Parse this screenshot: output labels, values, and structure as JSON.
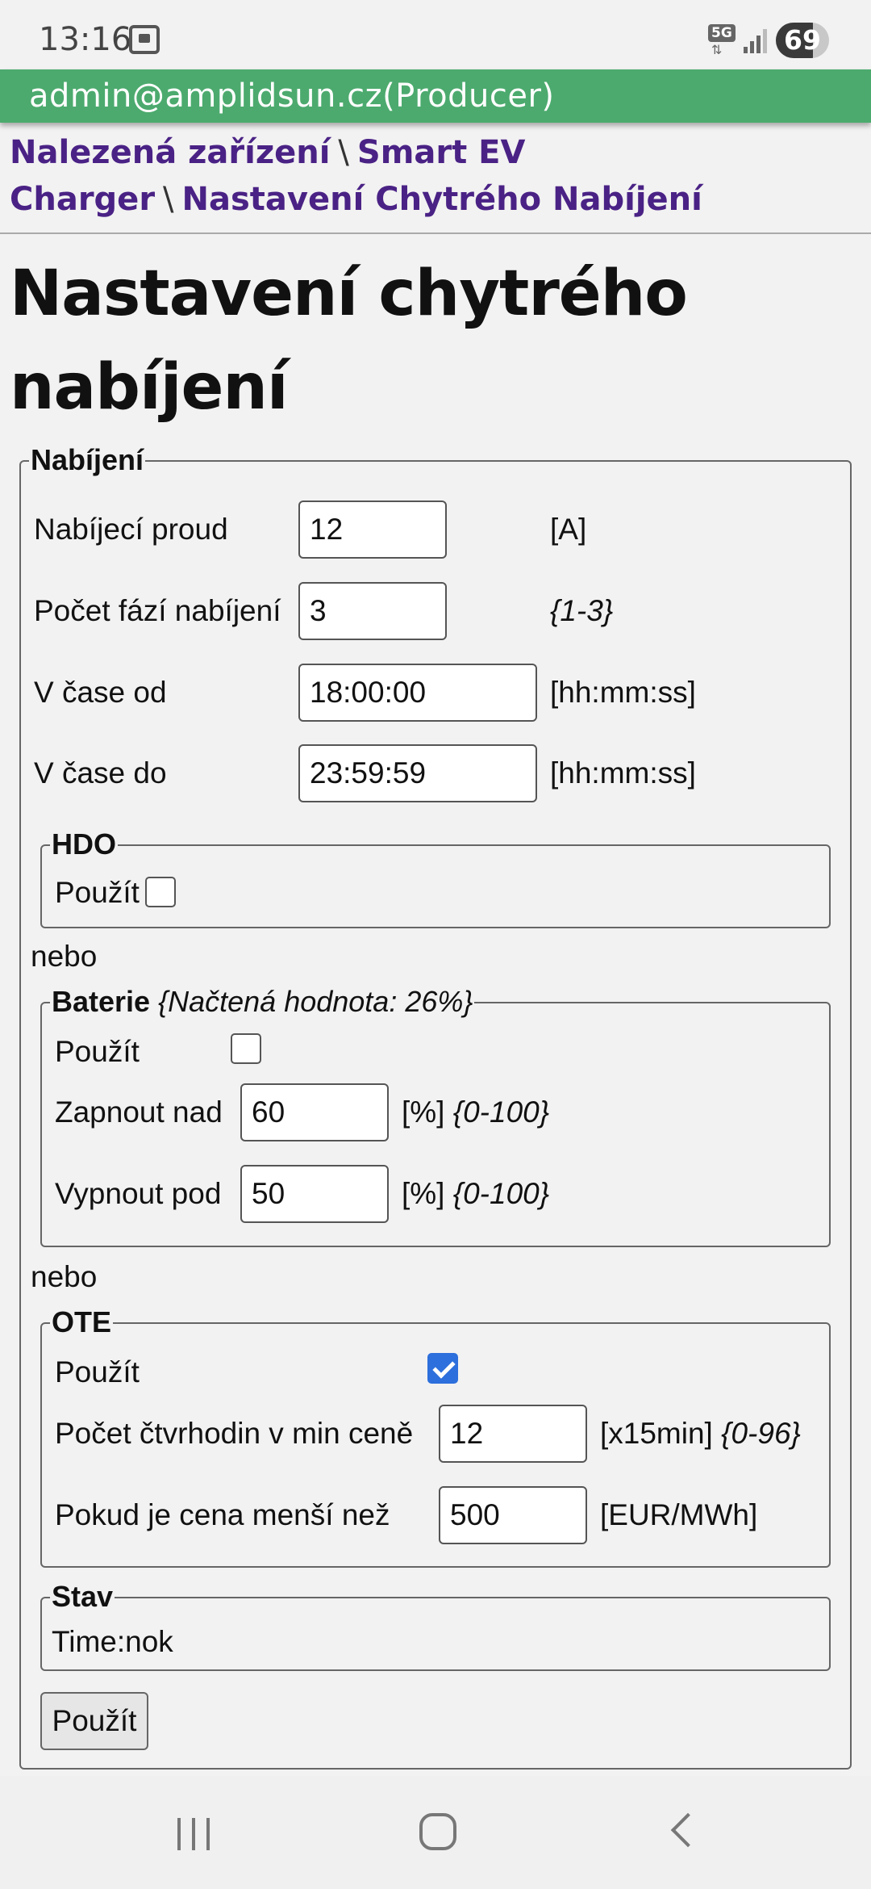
{
  "status": {
    "time": "13:16",
    "network": "5G",
    "battery": "69",
    "battery_level": 0.69
  },
  "header": {
    "user": "admin@amplidsun.cz(Producer)"
  },
  "breadcrumb": {
    "item1": "Nalezená zařízení",
    "item2": "Smart EV Charger",
    "item3": "Nastavení Chytrého Nabíjení",
    "separator": "\\"
  },
  "page": {
    "title": "Nastavení chytrého nabíjení",
    "or_label": "nebo"
  },
  "charging": {
    "legend": "Nabíjení",
    "current_label": "Nabíjecí proud",
    "current_value": "12",
    "current_unit": "[A]",
    "phases_label": "Počet fází nabíjení",
    "phases_value": "3",
    "phases_range": "{1-3}",
    "time_from_label": "V čase od",
    "time_from_value": "18:00:00",
    "time_from_unit": "[hh:mm:ss]",
    "time_to_label": "V čase do",
    "time_to_value": "23:59:59",
    "time_to_unit": "[hh:mm:ss]"
  },
  "hdo": {
    "legend": "HDO",
    "use_label": "Použít",
    "use_checked": false
  },
  "battery_section": {
    "legend": "Baterie",
    "loaded_value": "{Načtená hodnota: 26%}",
    "use_label": "Použít",
    "use_checked": false,
    "on_above_label": "Zapnout nad",
    "on_above_value": "60",
    "on_above_unit": "[%]",
    "on_above_range": "{0-100}",
    "off_below_label": "Vypnout pod",
    "off_below_value": "50",
    "off_below_unit": "[%]",
    "off_below_range": "{0-100}"
  },
  "ote": {
    "legend": "OTE",
    "use_label": "Použít",
    "use_checked": true,
    "quarters_label": "Počet čtvrhodin v min ceně",
    "quarters_value": "12",
    "quarters_unit": "[x15min]",
    "quarters_range": "{0-96}",
    "price_label": "Pokud je cena menší než",
    "price_value": "500",
    "price_unit": "[EUR/MWh]"
  },
  "state": {
    "legend": "Stav",
    "value": "Time:nok"
  },
  "apply_button": "Použít"
}
